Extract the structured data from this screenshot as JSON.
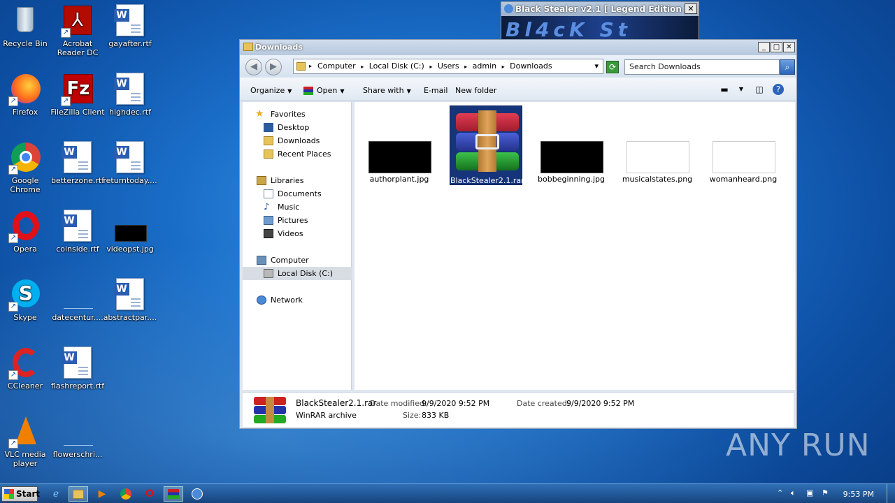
{
  "desktop": {
    "icons": [
      {
        "label": "Recycle Bin"
      },
      {
        "label": "Acrobat\nReader DC"
      },
      {
        "label": "gayafter.rtf"
      },
      {
        "label": "Firefox"
      },
      {
        "label": "FileZilla Client"
      },
      {
        "label": "highdec.rtf"
      },
      {
        "label": "Google\nChrome"
      },
      {
        "label": "betterzone.rtf"
      },
      {
        "label": "returntoday...."
      },
      {
        "label": "Opera"
      },
      {
        "label": "coinside.rtf"
      },
      {
        "label": "videopst.jpg"
      },
      {
        "label": "Skype"
      },
      {
        "label": "datecentur...."
      },
      {
        "label": "abstractpar...."
      },
      {
        "label": "CCleaner"
      },
      {
        "label": "flashreport.rtf"
      },
      {
        "label": "VLC media\nplayer"
      },
      {
        "label": "flowerschri..."
      }
    ],
    "watermark": "ANY RUN"
  },
  "stealer_window": {
    "title": "Black Stealer v2.1 [ Legend Edition ]",
    "close": "✕",
    "art_text": "Bl4cK St"
  },
  "explorer": {
    "title": "Downloads",
    "window_buttons": {
      "min": "_",
      "max": "□",
      "close": "✕"
    },
    "address": {
      "crumbs": [
        "Computer",
        "Local Disk (C:)",
        "Users",
        "admin",
        "Downloads"
      ],
      "separator": "▸"
    },
    "search": {
      "placeholder": "Search Downloads"
    },
    "toolbar": {
      "organize": "Organize",
      "open": "Open",
      "share_with": "Share with",
      "email": "E-mail",
      "new_folder": "New folder"
    },
    "nav": {
      "favorites": "Favorites",
      "desktop": "Desktop",
      "downloads": "Downloads",
      "recent": "Recent Places",
      "libraries": "Libraries",
      "documents": "Documents",
      "music": "Music",
      "pictures": "Pictures",
      "videos": "Videos",
      "computer": "Computer",
      "local_disk": "Local Disk (C:)",
      "network": "Network"
    },
    "files": [
      {
        "name": "authorplant.jpg"
      },
      {
        "name": "BlackStealer2.1.rar"
      },
      {
        "name": "bobbeginning.jpg"
      },
      {
        "name": "musicalstates.png"
      },
      {
        "name": "womanheard.png"
      }
    ],
    "details": {
      "name": "BlackStealer2.1.rar",
      "type": "WinRAR archive",
      "modified_label": "Date modified:",
      "modified_value": "9/9/2020 9:52 PM",
      "created_label": "Date created:",
      "created_value": "9/9/2020 9:52 PM",
      "size_label": "Size:",
      "size_value": "833 KB"
    }
  },
  "taskbar": {
    "start": "Start",
    "clock": "9:53 PM"
  },
  "colors": {
    "selection": "#15347a",
    "desktop": "#1a6ec8"
  }
}
